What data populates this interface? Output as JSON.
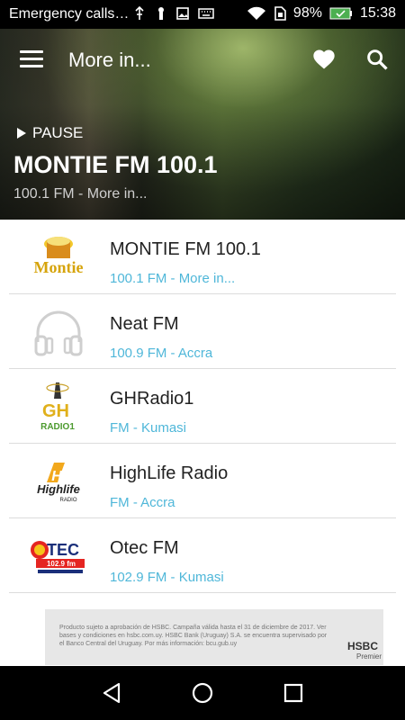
{
  "status_bar": {
    "carrier_text": "Emergency calls…",
    "battery": "98%",
    "time": "15:38",
    "icons": [
      "usb-icon",
      "lock-icon",
      "image-icon",
      "keyboard-icon",
      "wifi-icon",
      "sim-icon",
      "battery-icon"
    ]
  },
  "toolbar": {
    "title": "More in...",
    "menu_icon": "hamburger-menu-icon",
    "favorite_icon": "heart-icon",
    "search_icon": "search-icon"
  },
  "now_playing": {
    "state_label": "PAUSE",
    "title": "MONTIE FM 100.1",
    "subtitle": "100.1 FM - More in..."
  },
  "stations": [
    {
      "name": "MONTIE FM 100.1",
      "detail": "100.1 FM - More in...",
      "logo": "montie-logo",
      "logo_text": "Montie"
    },
    {
      "name": "Neat FM",
      "detail": "100.9 FM - Accra",
      "logo": "headphones-placeholder-icon",
      "logo_text": ""
    },
    {
      "name": "GHRadio1",
      "detail": " FM - Kumasi",
      "logo": "ghradio-logo",
      "logo_text": "GH Radio1"
    },
    {
      "name": "HighLife Radio",
      "detail": " FM - Accra",
      "logo": "highlife-logo",
      "logo_text": "Highlife RADIO"
    },
    {
      "name": "Otec FM",
      "detail": "102.9 FM - Kumasi",
      "logo": "otec-logo",
      "logo_text": "OTEC 102.9 fm"
    }
  ],
  "ad": {
    "text": "Producto sujeto a aprobación de HSBC. Campaña válida hasta el 31 de diciembre de 2017. Ver bases y condiciones en hsbc.com.uy. HSBC Bank (Uruguay) S.A. se encuentra supervisado por el Banco Central del Uruguay. Por más información: bcu.gub.uy",
    "brand": "HSBC",
    "brand_sub": "Premier"
  },
  "colors": {
    "accent_blue": "#4fb7d9",
    "divider": "#dcdcdc"
  }
}
